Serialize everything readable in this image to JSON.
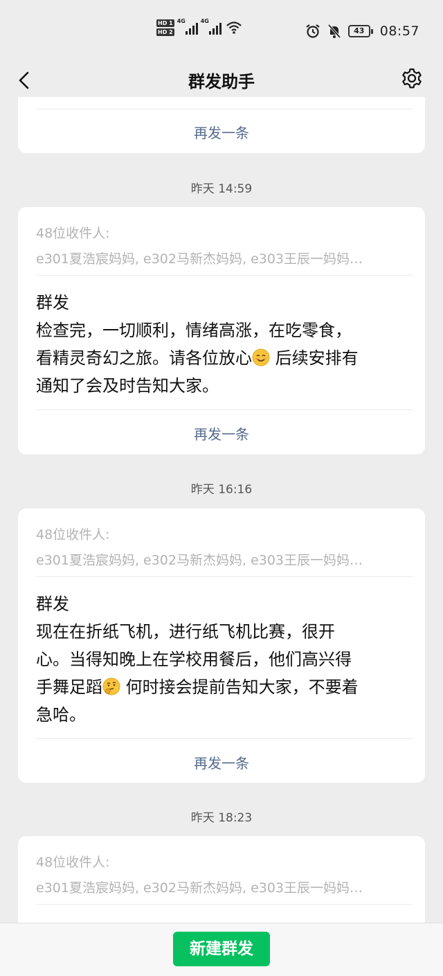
{
  "status_bar": {
    "sim1_label": "HD 1",
    "sim2_label": "HD 2",
    "signal1_label": "4G",
    "signal2_label": "4G",
    "battery": "43",
    "time": "08:57"
  },
  "header": {
    "title": "群发助手",
    "back_icon": "chevron-left-icon",
    "settings_icon": "gear-icon"
  },
  "messages": [
    {
      "resend_label": "再发一条"
    },
    {
      "timestamp": "昨天 14:59",
      "recipients_label": "48位收件人:",
      "recipients_list": "e301夏浩宸妈妈, e302马新杰妈妈, e303王辰一妈妈…",
      "body_lines": [
        "群发",
        "检查完，一切顺利，情绪高涨，在吃零食，",
        "看精灵奇幻之旅。请各位放心",
        "通知了会及时告知大家。"
      ],
      "body_line3_after_emoji": " 后续安排有",
      "resend_label": "再发一条"
    },
    {
      "timestamp": "昨天 16:16",
      "recipients_label": "48位收件人:",
      "recipients_list": "e301夏浩宸妈妈, e302马新杰妈妈, e303王辰一妈妈…",
      "body_lines": [
        "群发",
        "现在在折纸飞机，进行纸飞机比赛，很开",
        "心。当得知晚上在学校用餐后，他们高兴得",
        "手舞足蹈",
        "急哈。"
      ],
      "body_line4_after_emoji": " 何时接会提前告知大家，不要着",
      "resend_label": "再发一条"
    },
    {
      "timestamp": "昨天 18:23",
      "recipients_label": "48位收件人:",
      "recipients_list": "e301夏浩宸妈妈, e302马新杰妈妈, e303王辰一妈妈…"
    }
  ],
  "bottom": {
    "new_broadcast_label": "新建群发"
  },
  "colors": {
    "accent_green": "#07c160",
    "link_blue": "#556a8c",
    "background": "#ededed"
  }
}
